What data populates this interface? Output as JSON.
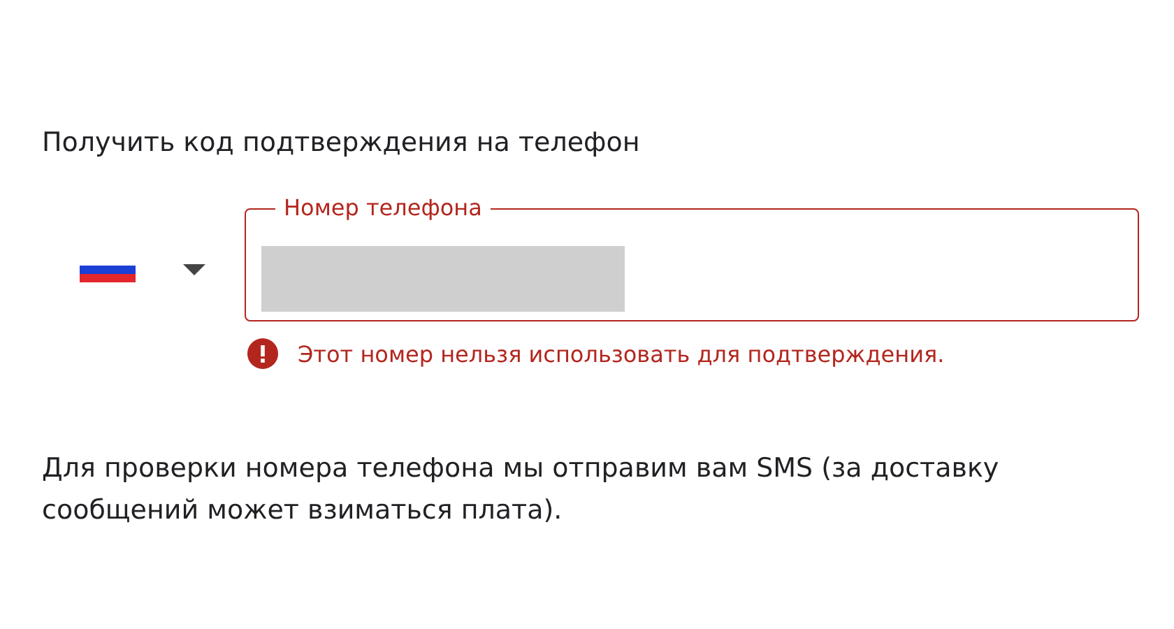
{
  "heading": "Получить код подтверждения на телефон",
  "country_select": {
    "expanded": false
  },
  "phone_field": {
    "label": "Номер телефона",
    "error": true,
    "value_masked": true
  },
  "error_message": "Этот номер нельзя использовать для подтверждения.",
  "note": "Для проверки номера телефона мы отправим вам SMS (за доставку сообщений может взиматься плата)."
}
